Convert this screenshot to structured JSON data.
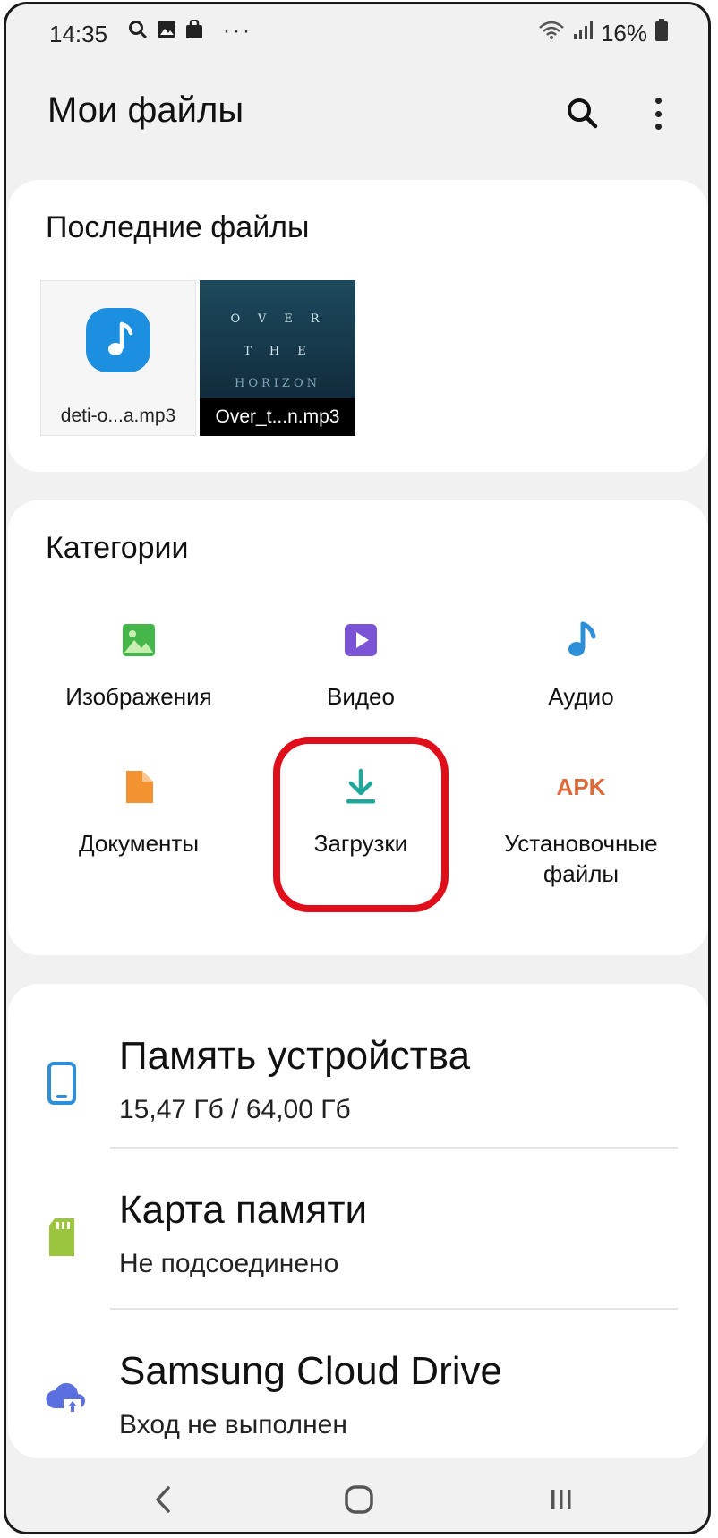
{
  "status_bar": {
    "time": "14:35",
    "overflow": "···",
    "battery_percent": "16%",
    "icons": [
      "search-icon",
      "gallery-icon",
      "bag-icon",
      "wifi-icon",
      "signal-icon",
      "battery-icon"
    ]
  },
  "header": {
    "title": "Мои файлы",
    "icons": [
      "search-icon",
      "more-vertical-icon"
    ]
  },
  "recent": {
    "title": "Последние файлы",
    "files": [
      {
        "label": "deti-o...a.mp3",
        "icon": "music-note-icon"
      },
      {
        "label": "Over_t...n.mp3",
        "cover_lines": [
          "OVER",
          "THE",
          "HORIZON"
        ]
      }
    ]
  },
  "categories": {
    "title": "Категории",
    "items": [
      {
        "label": "Изображения",
        "icon": "image-icon",
        "color": "#45b649"
      },
      {
        "label": "Видео",
        "icon": "video-icon",
        "color": "#7b54d6"
      },
      {
        "label": "Аудио",
        "icon": "audio-icon",
        "color": "#2c8fd8"
      },
      {
        "label": "Документы",
        "icon": "document-icon",
        "color": "#f39230"
      },
      {
        "label": "Загрузки",
        "icon": "download-icon",
        "color": "#1ea79a"
      },
      {
        "label": "Установочные файлы",
        "icon_text": "APK",
        "color": "#de6a3a"
      }
    ],
    "highlight_color": "#e00d1a"
  },
  "storage": [
    {
      "title": "Память устройства",
      "subtitle": "15,47 Гб / 64,00 Гб",
      "icon": "phone-icon",
      "color": "#2c8fd8"
    },
    {
      "title": "Карта памяти",
      "subtitle": "Не подсоединено",
      "icon": "sd-card-icon",
      "color": "#9ac53d"
    },
    {
      "title": "Samsung Cloud Drive",
      "subtitle": "Вход не выполнен",
      "icon": "cloud-upload-icon",
      "color": "#5b6fe0"
    }
  ],
  "nav": {
    "icons": [
      "back-icon",
      "home-icon",
      "recents-icon"
    ]
  }
}
